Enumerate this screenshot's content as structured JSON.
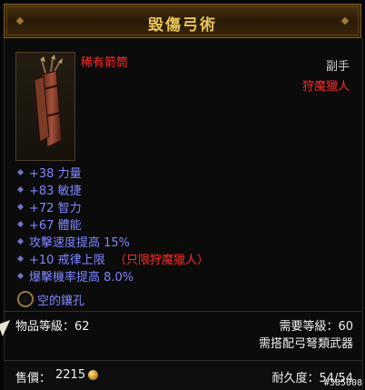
{
  "item": {
    "name": "毀傷弓術",
    "rarity_type": "稀有箭筒",
    "slot": "副手",
    "class_restriction": "狩魔獵人",
    "icon": "quiver-icon"
  },
  "stats": [
    {
      "text": "+38 力量",
      "extra": ""
    },
    {
      "text": "+83 敏捷",
      "extra": ""
    },
    {
      "text": "+72 智力",
      "extra": ""
    },
    {
      "text": "+67 體能",
      "extra": ""
    },
    {
      "text": "攻擊速度提高 15%",
      "extra": ""
    },
    {
      "text": "+10 戒律上限",
      "extra": "（只限狩魔獵人）"
    },
    {
      "text": "爆擊機率提高 8.0%",
      "extra": ""
    }
  ],
  "socket": {
    "label": "空的鑲孔"
  },
  "requirements": {
    "item_level": "物品等級：62",
    "required_level": "需要等級：60",
    "weapon_req": "需搭配弓弩類武器"
  },
  "footer": {
    "sell_price_label": "售價：",
    "sell_price": "2215",
    "durability": "耐久度：54/54"
  },
  "watermark": "#385608",
  "colors": {
    "title": "#e6c35a",
    "rare_name": "#ff2a2a",
    "stat_blue": "#7e86ff",
    "restriction_red": "#ff2a2a"
  }
}
